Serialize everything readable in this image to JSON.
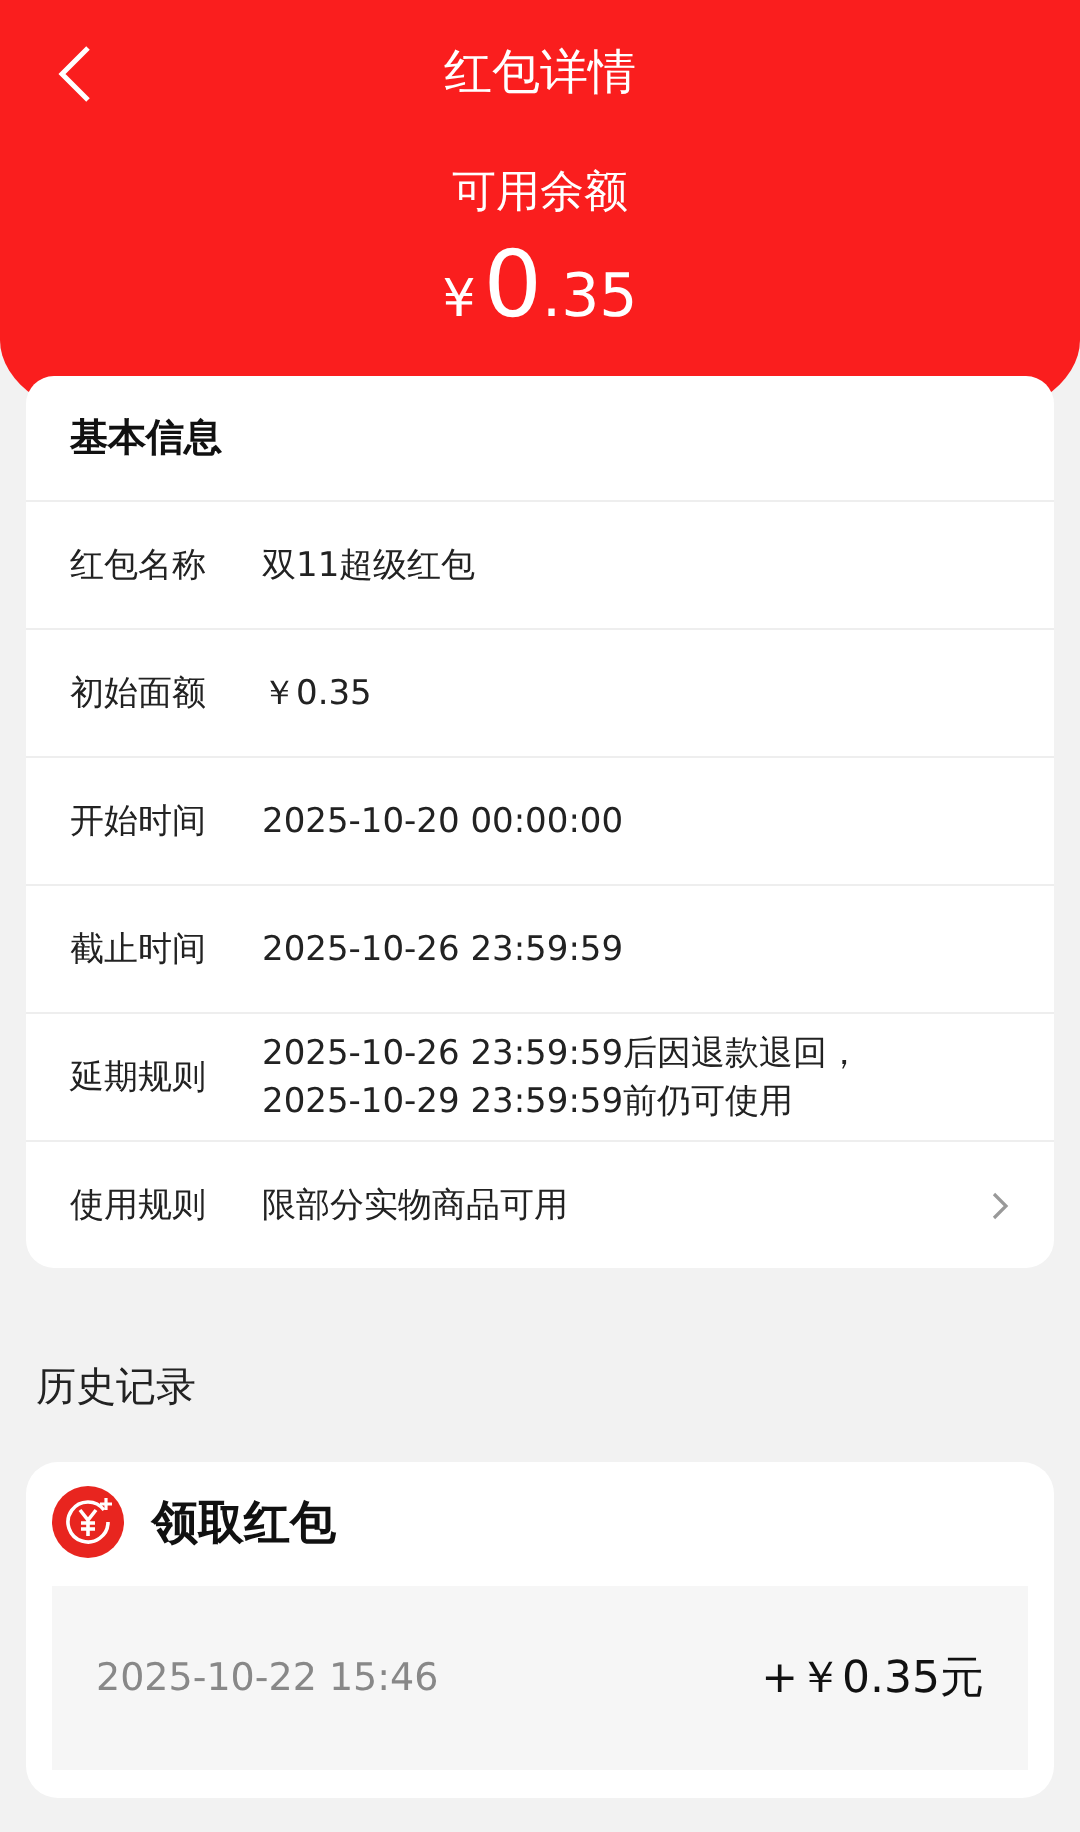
{
  "header": {
    "title": "红包详情",
    "balance_label": "可用余额",
    "currency": "¥",
    "amount_integer": "0",
    "amount_decimal": ".35"
  },
  "info": {
    "title": "基本信息",
    "rows": [
      {
        "kind": "text",
        "label": "红包名称",
        "lines": [
          "双11超级红包"
        ]
      },
      {
        "kind": "text",
        "label": "初始面额",
        "lines": [
          "￥0.35"
        ]
      },
      {
        "kind": "text",
        "label": "开始时间",
        "lines": [
          "2025-10-20 00:00:00"
        ]
      },
      {
        "kind": "text",
        "label": "截止时间",
        "lines": [
          "2025-10-26 23:59:59"
        ]
      },
      {
        "kind": "text",
        "label": "延期规则",
        "lines": [
          "2025-10-26 23:59:59后因退款退回，",
          "2025-10-29 23:59:59前仍可使用"
        ]
      },
      {
        "kind": "link",
        "label": "使用规则",
        "lines": [
          "限部分实物商品可用"
        ]
      }
    ]
  },
  "history": {
    "title": "历史记录",
    "groups": [
      {
        "title": "领取红包",
        "records": [
          {
            "time": "2025-10-22 15:46",
            "amount": "+￥0.35元"
          }
        ]
      }
    ]
  }
}
